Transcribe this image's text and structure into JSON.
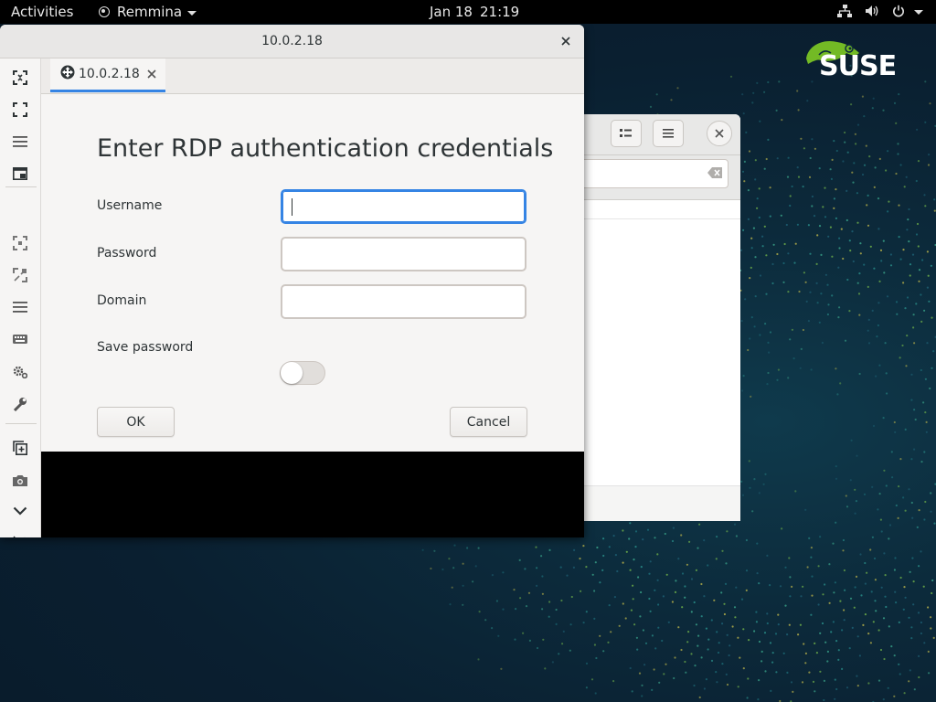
{
  "topbar": {
    "activities": "Activities",
    "app_menu": "Remmina",
    "date": "Jan 18",
    "time": "21:19"
  },
  "desktop": {
    "logo_text": "SUSE",
    "logo_color": "#73ba25"
  },
  "window": {
    "title": "10.0.2.18",
    "tab": {
      "label": "10.0.2.18"
    }
  },
  "dialog": {
    "heading": "Enter RDP authentication credentials",
    "username": {
      "label": "Username",
      "value": ""
    },
    "password": {
      "label": "Password",
      "value": ""
    },
    "domain": {
      "label": "Domain",
      "value": ""
    },
    "save_password": {
      "label": "Save password",
      "checked": false
    },
    "ok_label": "OK",
    "cancel_label": "Cancel"
  },
  "toolbar": {
    "icons": [
      "fit-window-icon",
      "fullscreen-icon",
      "menu-lines-icon",
      "multi-monitor-icon",
      "scale-icon",
      "dynamic-resolution-icon",
      "quality-menu-icon",
      "keyboard-icon",
      "preferences-icon",
      "tools-icon",
      "duplicate-icon",
      "screenshot-icon",
      "minimize-icon",
      "disconnect-icon"
    ]
  },
  "colors": {
    "accent": "#3584e4",
    "topbar": "#000000",
    "window_bg": "#f6f5f4"
  }
}
